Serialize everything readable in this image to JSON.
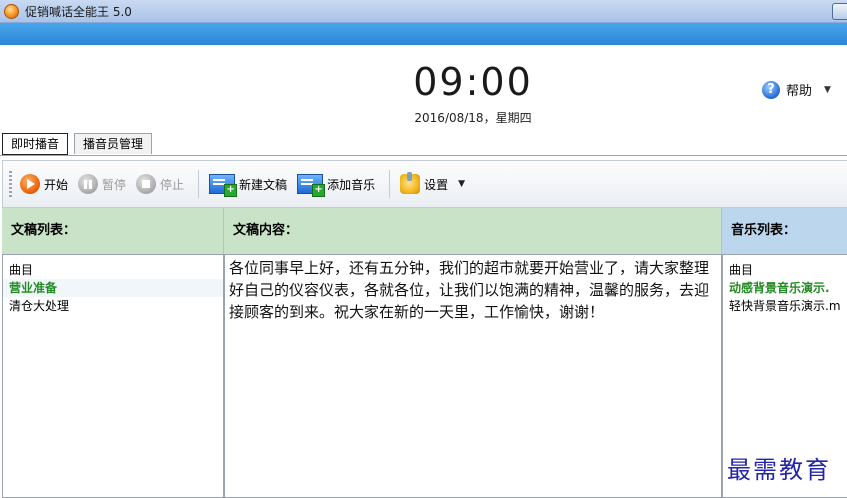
{
  "window": {
    "title": "促销喊话全能王 5.0"
  },
  "clock": {
    "time": "09:00",
    "date": "2016/08/18，星期四"
  },
  "help": {
    "label": "帮助"
  },
  "tabs": [
    {
      "label": "即时播音",
      "active": true
    },
    {
      "label": "播音员管理",
      "active": false
    }
  ],
  "toolbar": {
    "start_label": "开始",
    "pause_label": "暂停",
    "stop_label": "停止",
    "new_doc_label": "新建文稿",
    "add_music_label": "添加音乐",
    "settings_label": "设置"
  },
  "script_list": {
    "header": "文稿列表：",
    "column_label": "曲目",
    "items": [
      {
        "label": "营业准备",
        "selected": true
      },
      {
        "label": "清仓大处理",
        "selected": false
      }
    ]
  },
  "script_content": {
    "header": "文稿内容：",
    "text": "各位同事早上好，还有五分钟，我们的超市就要开始营业了，请大家整理好自己的仪容仪表，各就各位，让我们以饱满的精神，温馨的服务，去迎接顾客的到来。祝大家在新的一天里，工作愉快，谢谢！"
  },
  "music_list": {
    "header": "音乐列表：",
    "column_label": "曲目",
    "items": [
      {
        "label": "动感背景音乐演示.",
        "selected": true
      },
      {
        "label": "轻快背景音乐演示.m",
        "selected": false
      }
    ]
  },
  "watermark": {
    "text": "最需教育"
  },
  "colors": {
    "header_band": "#2a86d6",
    "list_header_green": "#c9e3c8",
    "list_header_blue": "#bcd6ee",
    "selected_item": "#228b22",
    "watermark": "#2424a8"
  }
}
